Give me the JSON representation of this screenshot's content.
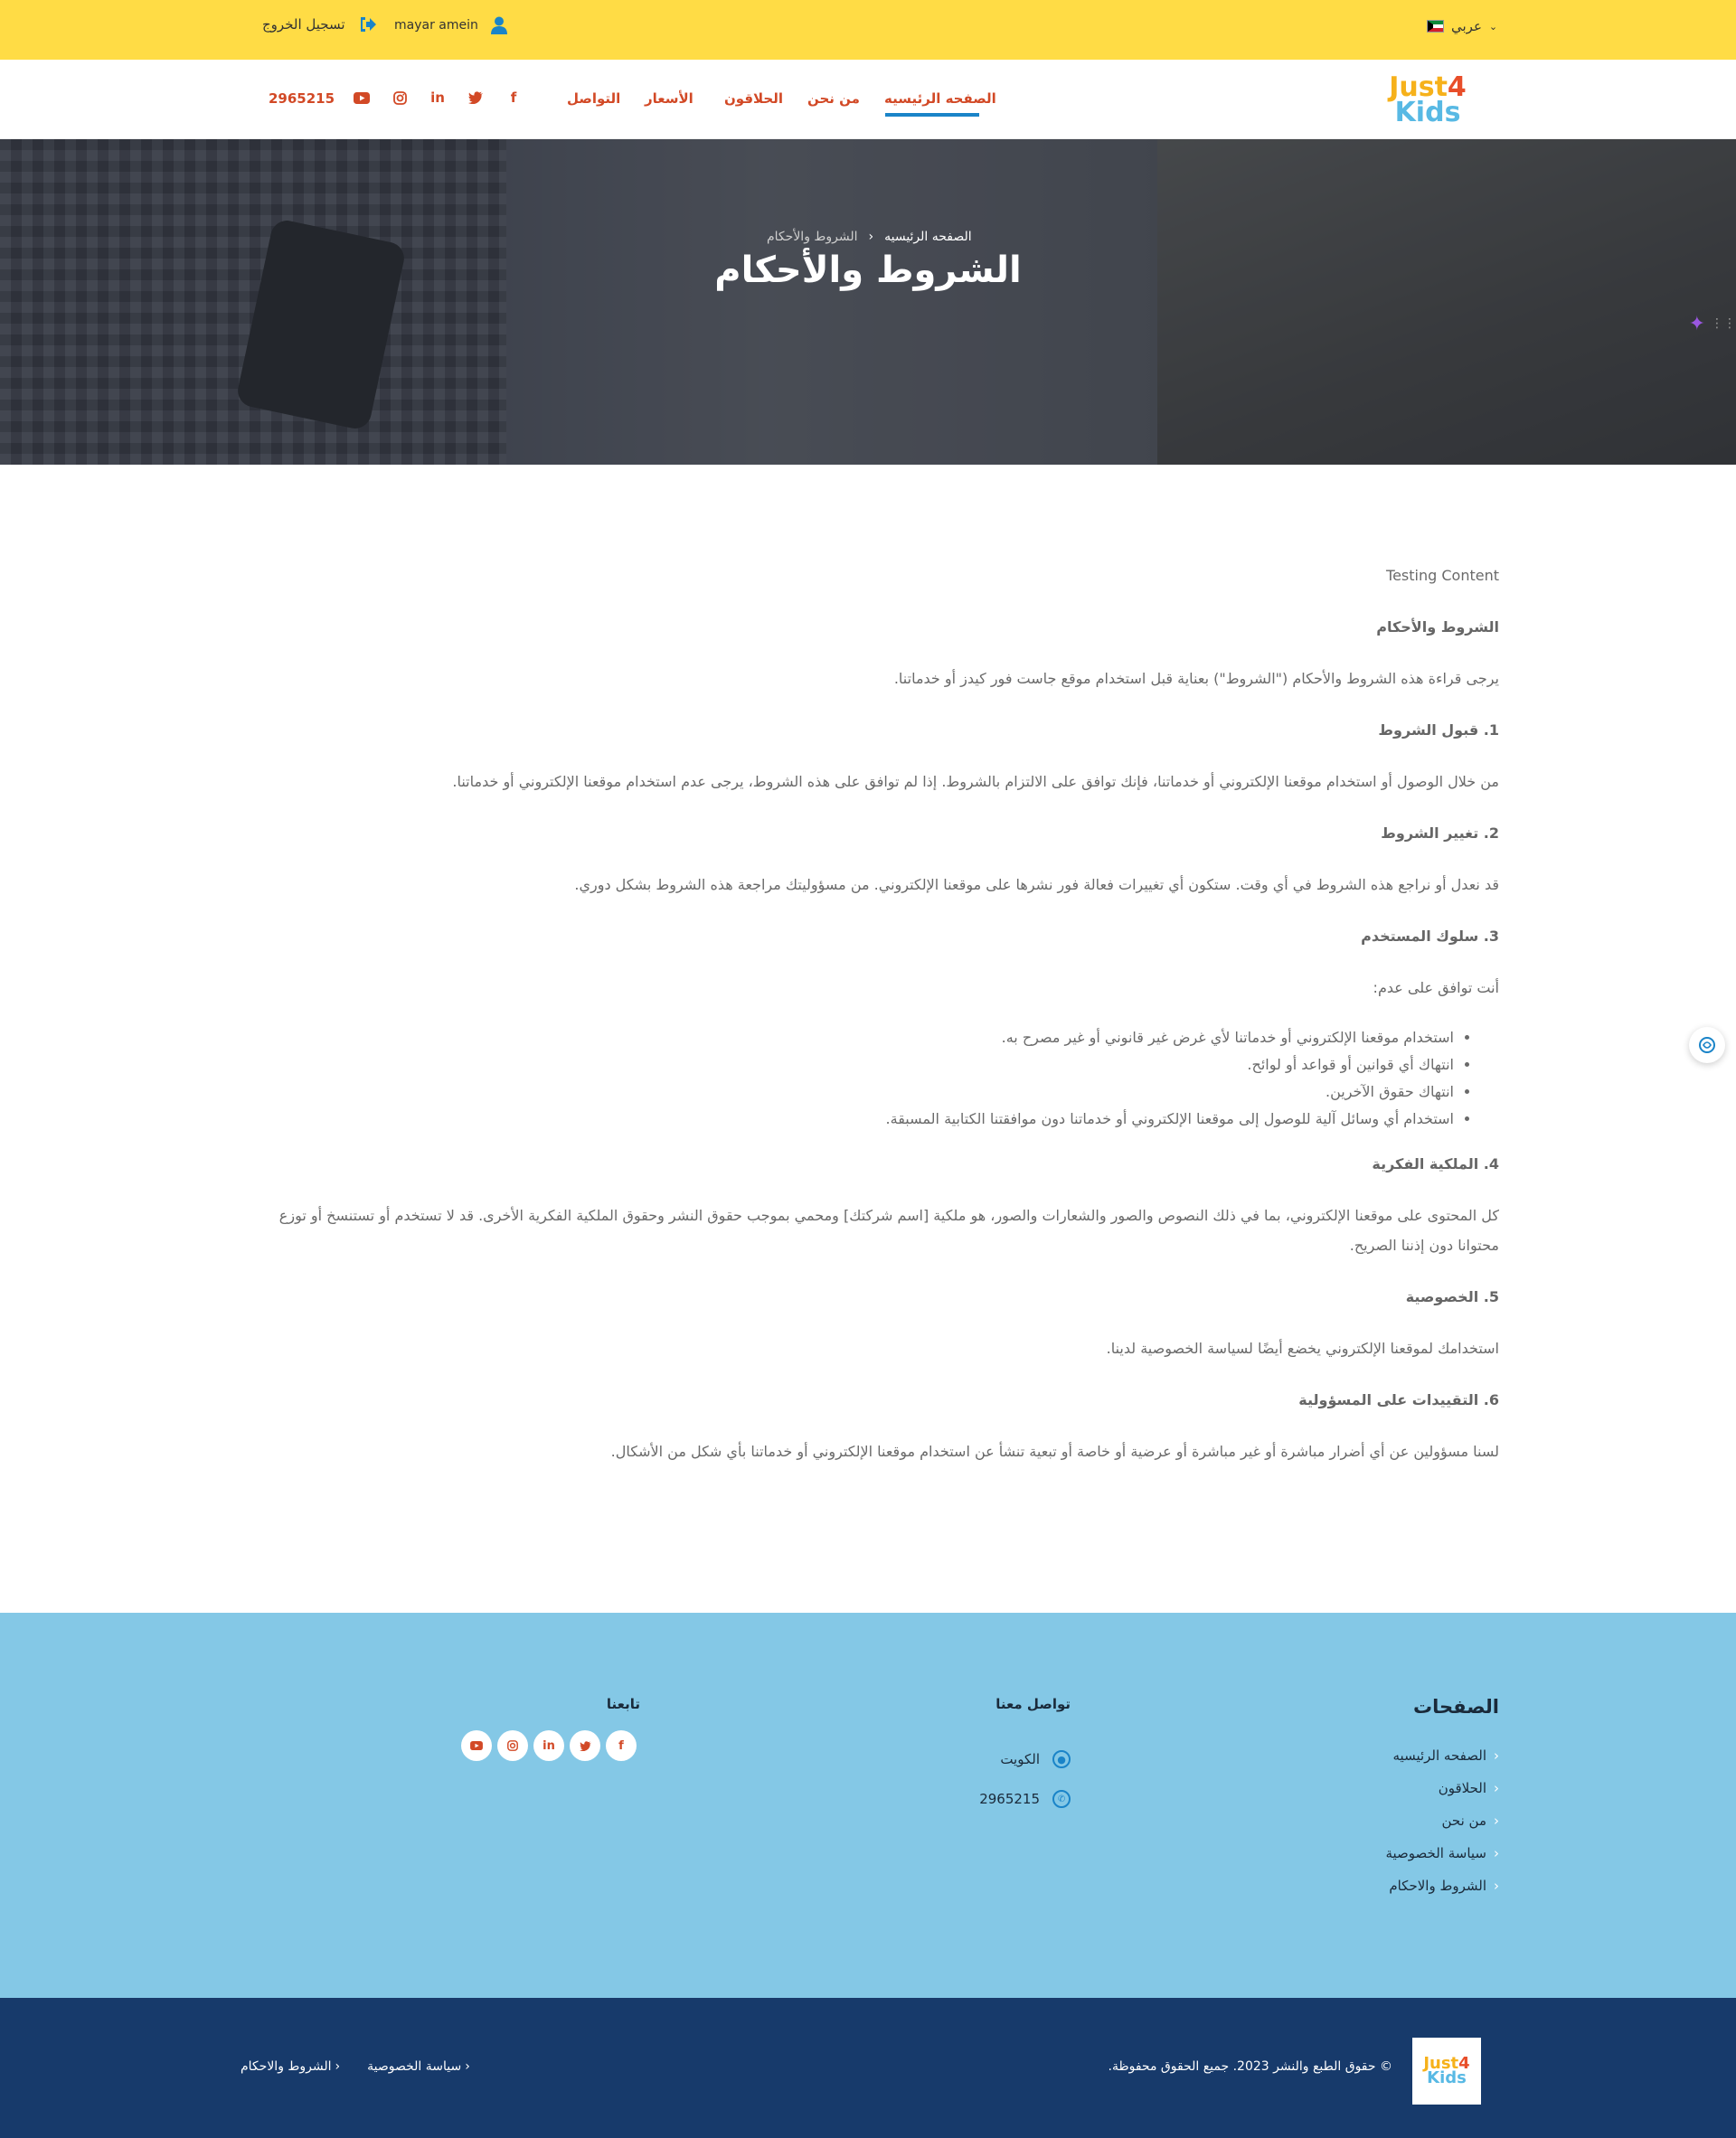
{
  "topbar": {
    "language": "عربي",
    "user_name": "mayar amein",
    "logout_label": "تسجيل الخروج"
  },
  "brand": {
    "logo_line1": "Just",
    "logo_number": "4",
    "logo_line2": "Kids"
  },
  "nav": {
    "items": [
      "الصفحه الرئيسيه",
      "من نحن",
      "الحلاقون",
      "الأسعار",
      "التواصل"
    ],
    "active_index": 0,
    "phone": "2965215",
    "social_icons": [
      "facebook-icon",
      "twitter-icon",
      "linkedin-icon",
      "instagram-icon",
      "youtube-icon"
    ]
  },
  "hero": {
    "breadcrumb_home": "الصفحه الرئيسيه",
    "breadcrumb_current": "الشروط والأحكام",
    "title": "الشروط والأحكام"
  },
  "content": {
    "intro": "Testing Content",
    "heading_main": "الشروط والأحكام",
    "para_intro": "يرجى قراءة هذه الشروط والأحكام (\"الشروط\") بعناية قبل استخدام موقع جاست فور كيدز أو خدماتنا.",
    "h1": "1. قبول الشروط",
    "p1": "من خلال الوصول أو استخدام موقعنا الإلكتروني أو خدماتنا، فإنك توافق على الالتزام بالشروط. إذا لم توافق على هذه الشروط، يرجى عدم استخدام موقعنا الإلكتروني أو خدماتنا.",
    "h2": "2. تغيير الشروط",
    "p2": "قد نعدل أو نراجع هذه الشروط في أي وقت. ستكون أي تغييرات فعالة فور نشرها على موقعنا الإلكتروني. من مسؤوليتك مراجعة هذه الشروط بشكل دوري.",
    "h3": "3. سلوك المستخدم",
    "p3": "أنت توافق على عدم:",
    "list": [
      "استخدام موقعنا الإلكتروني أو خدماتنا لأي غرض غير قانوني أو غير مصرح به.",
      "انتهاك أي قوانين أو قواعد أو لوائح.",
      "انتهاك حقوق الآخرين.",
      "استخدام أي وسائل آلية للوصول إلى موقعنا الإلكتروني أو خدماتنا دون موافقتنا الكتابية المسبقة."
    ],
    "h4": "4. الملكية الفكرية",
    "p4": "كل المحتوى على موقعنا الإلكتروني، بما في ذلك النصوص والصور والشعارات والصور، هو ملكية [اسم شركتك] ومحمي بموجب حقوق النشر وحقوق الملكية الفكرية الأخرى. قد لا تستخدم أو تستنسخ أو توزع محتوانا دون إذننا الصريح.",
    "h5": "5. الخصوصية",
    "p5": "استخدامك لموقعنا الإلكتروني يخضع أيضًا لسياسة الخصوصية لدينا.",
    "h6": "6. التقييدات على المسؤولية",
    "p6": "لسنا مسؤولين عن أي أضرار مباشرة أو غير مباشرة أو عرضية أو خاصة أو تبعية تنشأ عن استخدام موقعنا الإلكتروني أو خدماتنا بأي شكل من الأشكال."
  },
  "footer": {
    "pages_title": "الصفحات",
    "pages": [
      "الصفحه الرئيسيه",
      "الحلاقون",
      "من نحن",
      "سياسة الخصوصية",
      "الشروط والاحكام"
    ],
    "contact_title": "تواصل معنا",
    "location": "الكويت",
    "phone": "2965215",
    "follow_title": "تابعنا",
    "copyright": "© حقوق الطبع والنشر 2023. جميع الحقوق محفوظة.",
    "bottom_links": [
      "سياسة الخصوصية",
      "الشروط والاحكام"
    ]
  },
  "colors": {
    "topbar": "#ffdc45",
    "nav_text": "#d24926",
    "accent": "#1a84c8",
    "footer": "#84c8e6",
    "bottom": "#173a6b"
  }
}
